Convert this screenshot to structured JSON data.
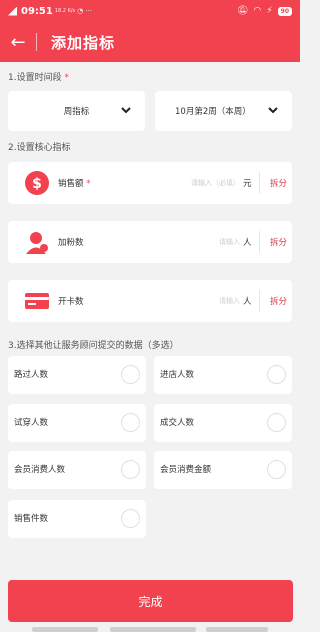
{
  "status_bar": {
    "time": "09:51",
    "net_small": "18.2 K/s",
    "battery": "90"
  },
  "header": {
    "title": "添加指标"
  },
  "period": {
    "label": "1.设置时间段",
    "required_mark": "*",
    "type_value": "周指标",
    "week_value": "10月第2周（本周）"
  },
  "core": {
    "label": "2.设置核心指标",
    "rows": [
      {
        "label": "销售额",
        "required_mark": "*",
        "placeholder": "请输入（必填）",
        "unit": "元",
        "split": "拆分"
      },
      {
        "label": "加粉数",
        "placeholder": "请输入",
        "unit": "人",
        "split": "拆分"
      },
      {
        "label": "开卡数",
        "placeholder": "请输入",
        "unit": "人",
        "split": "拆分"
      }
    ]
  },
  "extra": {
    "label": "3.选择其他让服务顾问提交的数据（多选）",
    "options": [
      "路过人数",
      "进店人数",
      "试穿人数",
      "成交人数",
      "会员消费人数",
      "会员消费金额",
      "销售件数"
    ]
  },
  "footer": {
    "done_label": "完成"
  },
  "colors": {
    "brand": "#f2414f",
    "split_text": "#d43a45"
  }
}
